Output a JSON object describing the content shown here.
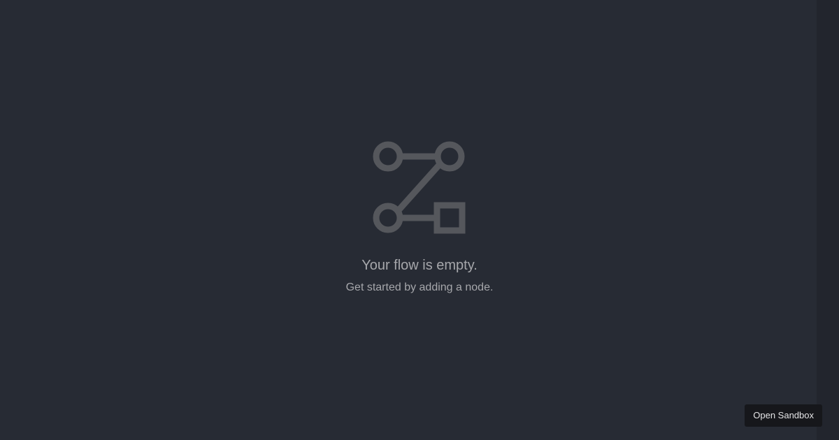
{
  "empty_state": {
    "icon": "flow-diagram-icon",
    "title": "Your flow is empty.",
    "subtitle": "Get started by adding a node."
  },
  "sandbox": {
    "label": "Open Sandbox"
  },
  "colors": {
    "background": "#272b34",
    "scroll_strip": "#22252d",
    "icon": "#55575c",
    "text": "#a6a7ab",
    "button_background": "#16171b",
    "button_text": "#e4e4e6"
  }
}
